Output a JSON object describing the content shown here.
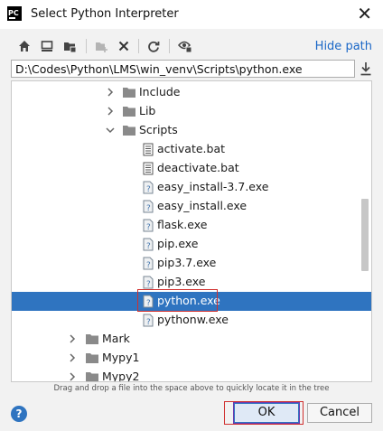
{
  "window": {
    "title": "Select Python Interpreter",
    "logo_text": "PC"
  },
  "toolbar": {
    "hide_path_label": "Hide path"
  },
  "path": {
    "value": "D:\\Codes\\Python\\LMS\\win_venv\\Scripts\\python.exe"
  },
  "tree": {
    "items": [
      {
        "label": "Include",
        "kind": "folder",
        "state": "collapsed"
      },
      {
        "label": "Lib",
        "kind": "folder",
        "state": "collapsed"
      },
      {
        "label": "Scripts",
        "kind": "folder",
        "state": "expanded"
      },
      {
        "label": "activate.bat",
        "kind": "text-file"
      },
      {
        "label": "deactivate.bat",
        "kind": "text-file"
      },
      {
        "label": "easy_install-3.7.exe",
        "kind": "exe-file"
      },
      {
        "label": "easy_install.exe",
        "kind": "exe-file"
      },
      {
        "label": "flask.exe",
        "kind": "exe-file"
      },
      {
        "label": "pip.exe",
        "kind": "exe-file"
      },
      {
        "label": "pip3.7.exe",
        "kind": "exe-file"
      },
      {
        "label": "pip3.exe",
        "kind": "exe-file"
      },
      {
        "label": "python.exe",
        "kind": "exe-file",
        "selected": true
      },
      {
        "label": "pythonw.exe",
        "kind": "exe-file"
      },
      {
        "label": "Mark",
        "kind": "folder",
        "state": "collapsed"
      },
      {
        "label": "Mypy1",
        "kind": "folder",
        "state": "collapsed"
      },
      {
        "label": "Mypy2",
        "kind": "folder",
        "state": "collapsed"
      }
    ]
  },
  "hint": "Drag and drop a file into the space above to quickly locate it in the tree",
  "footer": {
    "help_label": "?",
    "ok_label": "OK",
    "cancel_label": "Cancel"
  },
  "colors": {
    "selection": "#2f74c0",
    "link": "#1a67c7",
    "highlight_box": "#d0302f"
  }
}
